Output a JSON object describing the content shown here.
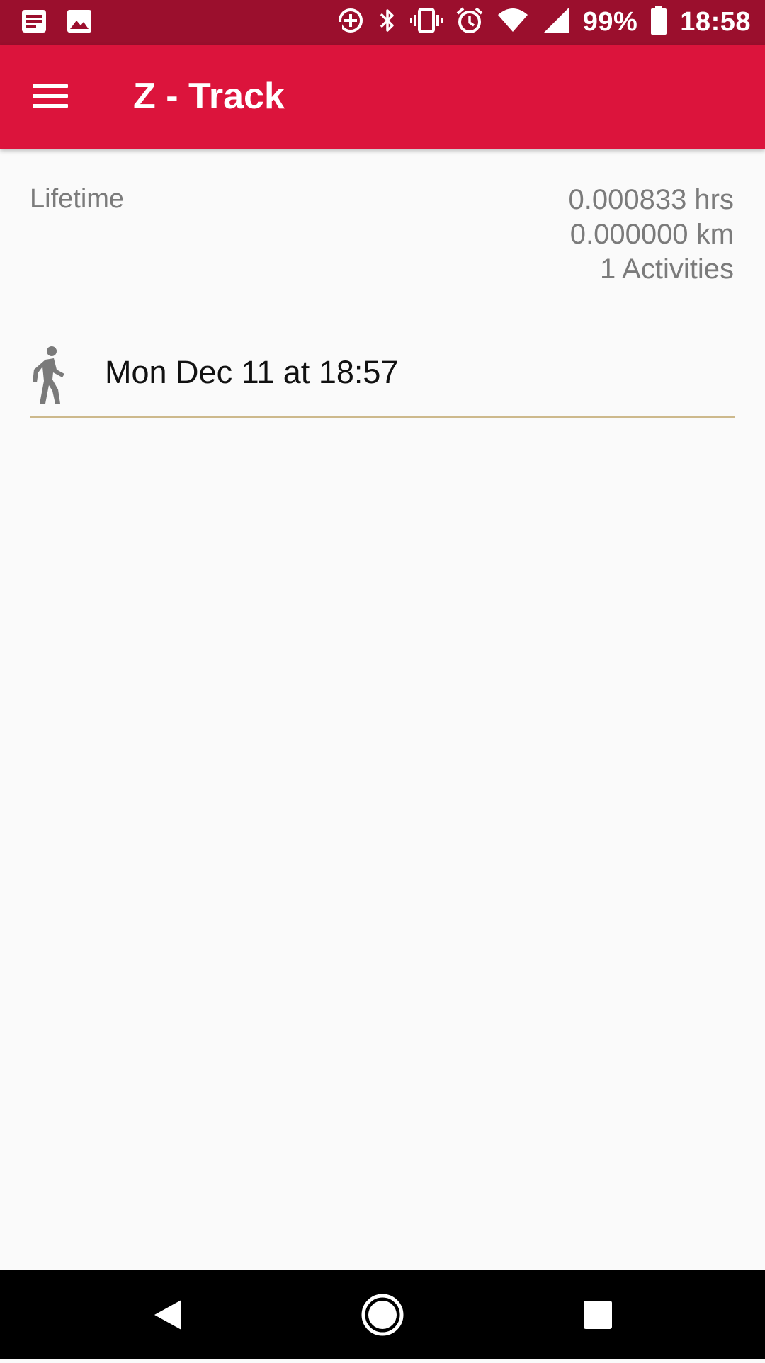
{
  "status_bar": {
    "battery_percent": "99%",
    "time": "18:58",
    "icons": [
      "news-icon",
      "image-icon",
      "data-saver-icon",
      "bluetooth-icon",
      "vibrate-icon",
      "alarm-icon",
      "wifi-icon",
      "signal-icon",
      "battery-icon"
    ]
  },
  "toolbar": {
    "title": "Z - Track",
    "menu_icon": "hamburger-menu-icon",
    "color": "#dc143c"
  },
  "lifetime": {
    "label": "Lifetime",
    "hours": "0.000833 hrs",
    "distance": "0.000000 km",
    "activities": "1 Activities"
  },
  "activities": [
    {
      "icon": "walking-person-icon",
      "label": "Mon Dec 11 at 18:57"
    }
  ],
  "nav_bar": {
    "buttons": [
      "back-icon",
      "home-icon",
      "recents-icon"
    ]
  },
  "colors": {
    "status_bar": "#9b0f2d",
    "accent": "#dc143c",
    "divider": "#cdb98c"
  }
}
